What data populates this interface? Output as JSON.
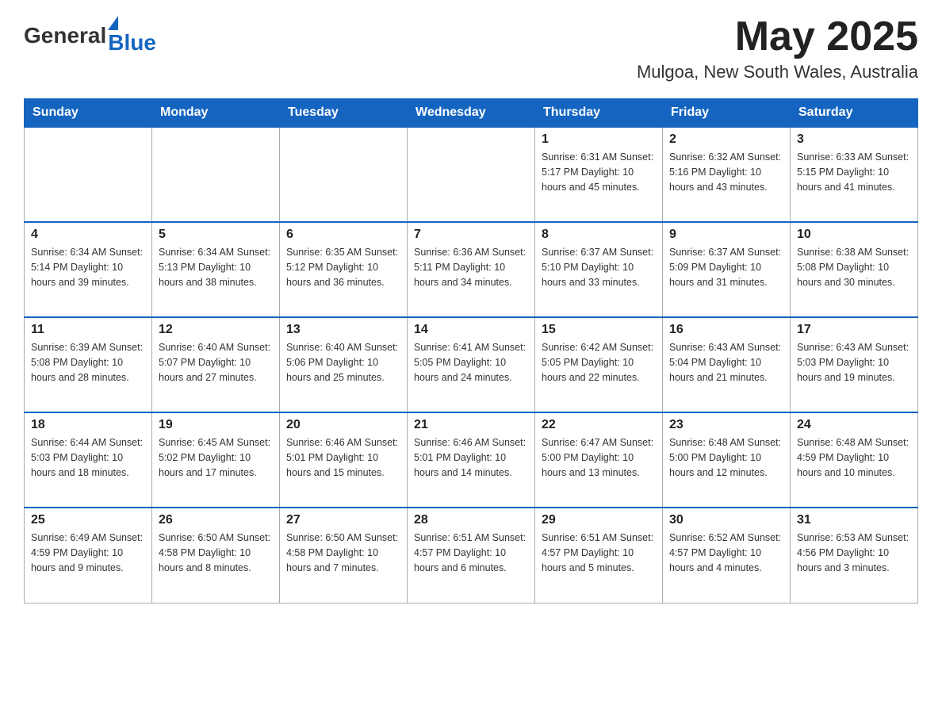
{
  "header": {
    "logo": {
      "general": "General",
      "blue": "Blue"
    },
    "title": "May 2025",
    "location": "Mulgoa, New South Wales, Australia"
  },
  "days_of_week": [
    "Sunday",
    "Monday",
    "Tuesday",
    "Wednesday",
    "Thursday",
    "Friday",
    "Saturday"
  ],
  "weeks": [
    [
      {
        "day": "",
        "info": ""
      },
      {
        "day": "",
        "info": ""
      },
      {
        "day": "",
        "info": ""
      },
      {
        "day": "",
        "info": ""
      },
      {
        "day": "1",
        "info": "Sunrise: 6:31 AM\nSunset: 5:17 PM\nDaylight: 10 hours and 45 minutes."
      },
      {
        "day": "2",
        "info": "Sunrise: 6:32 AM\nSunset: 5:16 PM\nDaylight: 10 hours and 43 minutes."
      },
      {
        "day": "3",
        "info": "Sunrise: 6:33 AM\nSunset: 5:15 PM\nDaylight: 10 hours and 41 minutes."
      }
    ],
    [
      {
        "day": "4",
        "info": "Sunrise: 6:34 AM\nSunset: 5:14 PM\nDaylight: 10 hours and 39 minutes."
      },
      {
        "day": "5",
        "info": "Sunrise: 6:34 AM\nSunset: 5:13 PM\nDaylight: 10 hours and 38 minutes."
      },
      {
        "day": "6",
        "info": "Sunrise: 6:35 AM\nSunset: 5:12 PM\nDaylight: 10 hours and 36 minutes."
      },
      {
        "day": "7",
        "info": "Sunrise: 6:36 AM\nSunset: 5:11 PM\nDaylight: 10 hours and 34 minutes."
      },
      {
        "day": "8",
        "info": "Sunrise: 6:37 AM\nSunset: 5:10 PM\nDaylight: 10 hours and 33 minutes."
      },
      {
        "day": "9",
        "info": "Sunrise: 6:37 AM\nSunset: 5:09 PM\nDaylight: 10 hours and 31 minutes."
      },
      {
        "day": "10",
        "info": "Sunrise: 6:38 AM\nSunset: 5:08 PM\nDaylight: 10 hours and 30 minutes."
      }
    ],
    [
      {
        "day": "11",
        "info": "Sunrise: 6:39 AM\nSunset: 5:08 PM\nDaylight: 10 hours and 28 minutes."
      },
      {
        "day": "12",
        "info": "Sunrise: 6:40 AM\nSunset: 5:07 PM\nDaylight: 10 hours and 27 minutes."
      },
      {
        "day": "13",
        "info": "Sunrise: 6:40 AM\nSunset: 5:06 PM\nDaylight: 10 hours and 25 minutes."
      },
      {
        "day": "14",
        "info": "Sunrise: 6:41 AM\nSunset: 5:05 PM\nDaylight: 10 hours and 24 minutes."
      },
      {
        "day": "15",
        "info": "Sunrise: 6:42 AM\nSunset: 5:05 PM\nDaylight: 10 hours and 22 minutes."
      },
      {
        "day": "16",
        "info": "Sunrise: 6:43 AM\nSunset: 5:04 PM\nDaylight: 10 hours and 21 minutes."
      },
      {
        "day": "17",
        "info": "Sunrise: 6:43 AM\nSunset: 5:03 PM\nDaylight: 10 hours and 19 minutes."
      }
    ],
    [
      {
        "day": "18",
        "info": "Sunrise: 6:44 AM\nSunset: 5:03 PM\nDaylight: 10 hours and 18 minutes."
      },
      {
        "day": "19",
        "info": "Sunrise: 6:45 AM\nSunset: 5:02 PM\nDaylight: 10 hours and 17 minutes."
      },
      {
        "day": "20",
        "info": "Sunrise: 6:46 AM\nSunset: 5:01 PM\nDaylight: 10 hours and 15 minutes."
      },
      {
        "day": "21",
        "info": "Sunrise: 6:46 AM\nSunset: 5:01 PM\nDaylight: 10 hours and 14 minutes."
      },
      {
        "day": "22",
        "info": "Sunrise: 6:47 AM\nSunset: 5:00 PM\nDaylight: 10 hours and 13 minutes."
      },
      {
        "day": "23",
        "info": "Sunrise: 6:48 AM\nSunset: 5:00 PM\nDaylight: 10 hours and 12 minutes."
      },
      {
        "day": "24",
        "info": "Sunrise: 6:48 AM\nSunset: 4:59 PM\nDaylight: 10 hours and 10 minutes."
      }
    ],
    [
      {
        "day": "25",
        "info": "Sunrise: 6:49 AM\nSunset: 4:59 PM\nDaylight: 10 hours and 9 minutes."
      },
      {
        "day": "26",
        "info": "Sunrise: 6:50 AM\nSunset: 4:58 PM\nDaylight: 10 hours and 8 minutes."
      },
      {
        "day": "27",
        "info": "Sunrise: 6:50 AM\nSunset: 4:58 PM\nDaylight: 10 hours and 7 minutes."
      },
      {
        "day": "28",
        "info": "Sunrise: 6:51 AM\nSunset: 4:57 PM\nDaylight: 10 hours and 6 minutes."
      },
      {
        "day": "29",
        "info": "Sunrise: 6:51 AM\nSunset: 4:57 PM\nDaylight: 10 hours and 5 minutes."
      },
      {
        "day": "30",
        "info": "Sunrise: 6:52 AM\nSunset: 4:57 PM\nDaylight: 10 hours and 4 minutes."
      },
      {
        "day": "31",
        "info": "Sunrise: 6:53 AM\nSunset: 4:56 PM\nDaylight: 10 hours and 3 minutes."
      }
    ]
  ]
}
